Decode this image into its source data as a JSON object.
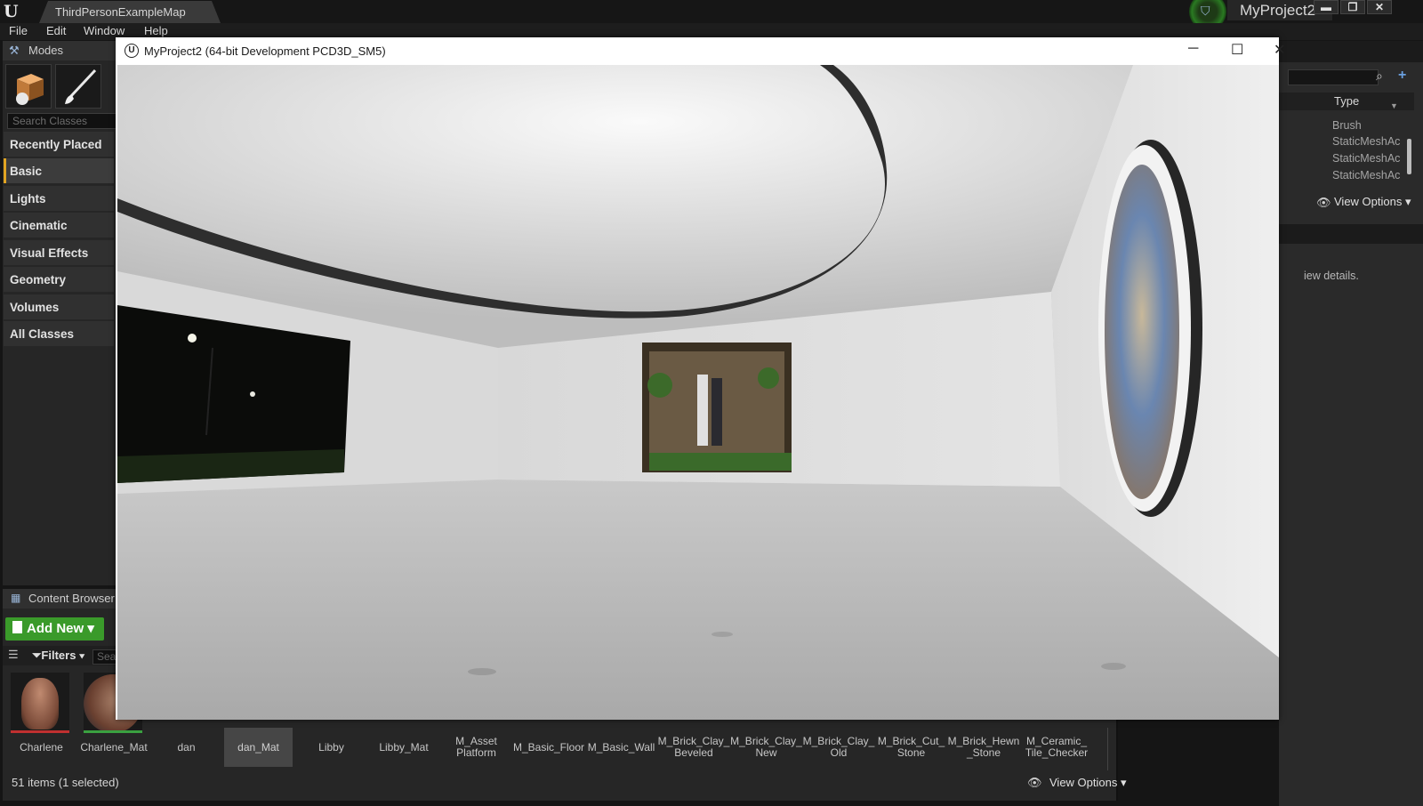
{
  "editor": {
    "map_tab": "ThirdPersonExampleMap",
    "project_name": "MyProject2",
    "window_controls": {
      "minimize": "▬",
      "restore": "❐",
      "close": "✕"
    },
    "menu": [
      "File",
      "Edit",
      "Window",
      "Help"
    ]
  },
  "modes": {
    "title": "Modes",
    "search_placeholder": "Search Classes",
    "categories": [
      "Recently Placed",
      "Basic",
      "Lights",
      "Cinematic",
      "Visual Effects",
      "Geometry",
      "Volumes",
      "All Classes"
    ],
    "active_category": "Basic",
    "accent_color": "#e0a422"
  },
  "outliner": {
    "type_header": "Type",
    "rows": [
      "Brush",
      "StaticMeshAc",
      "StaticMeshAc",
      "StaticMeshAc"
    ],
    "view_options": "View Options ▾"
  },
  "details": {
    "hint": "iew details."
  },
  "content_browser": {
    "title": "Content Browser",
    "add_new": "Add New ▾",
    "filters": "Filters ▾",
    "search_placeholder": "Sea",
    "assets": [
      "Charlene",
      "Charlene_Mat",
      "dan",
      "dan_Mat",
      "Libby",
      "Libby_Mat",
      "M_Asset\nPlatform",
      "M_Basic_Floor",
      "M_Basic_Wall",
      "M_Brick_Clay_\nBeveled",
      "M_Brick_Clay_\nNew",
      "M_Brick_Clay_\nOld",
      "M_Brick_Cut_\nStone",
      "M_Brick_Hewn\n_Stone",
      "M_Ceramic_\nTile_Checker"
    ],
    "selected_asset": "dan_Mat",
    "status": "51 items (1 selected)",
    "view_options": "View Options ▾",
    "accent_color": "#3a9a2a"
  },
  "game_window": {
    "title": "MyProject2 (64-bit Development PCD3D_SM5)",
    "controls": {
      "minimize": "─",
      "maximize": "☐",
      "close": "✕"
    }
  }
}
